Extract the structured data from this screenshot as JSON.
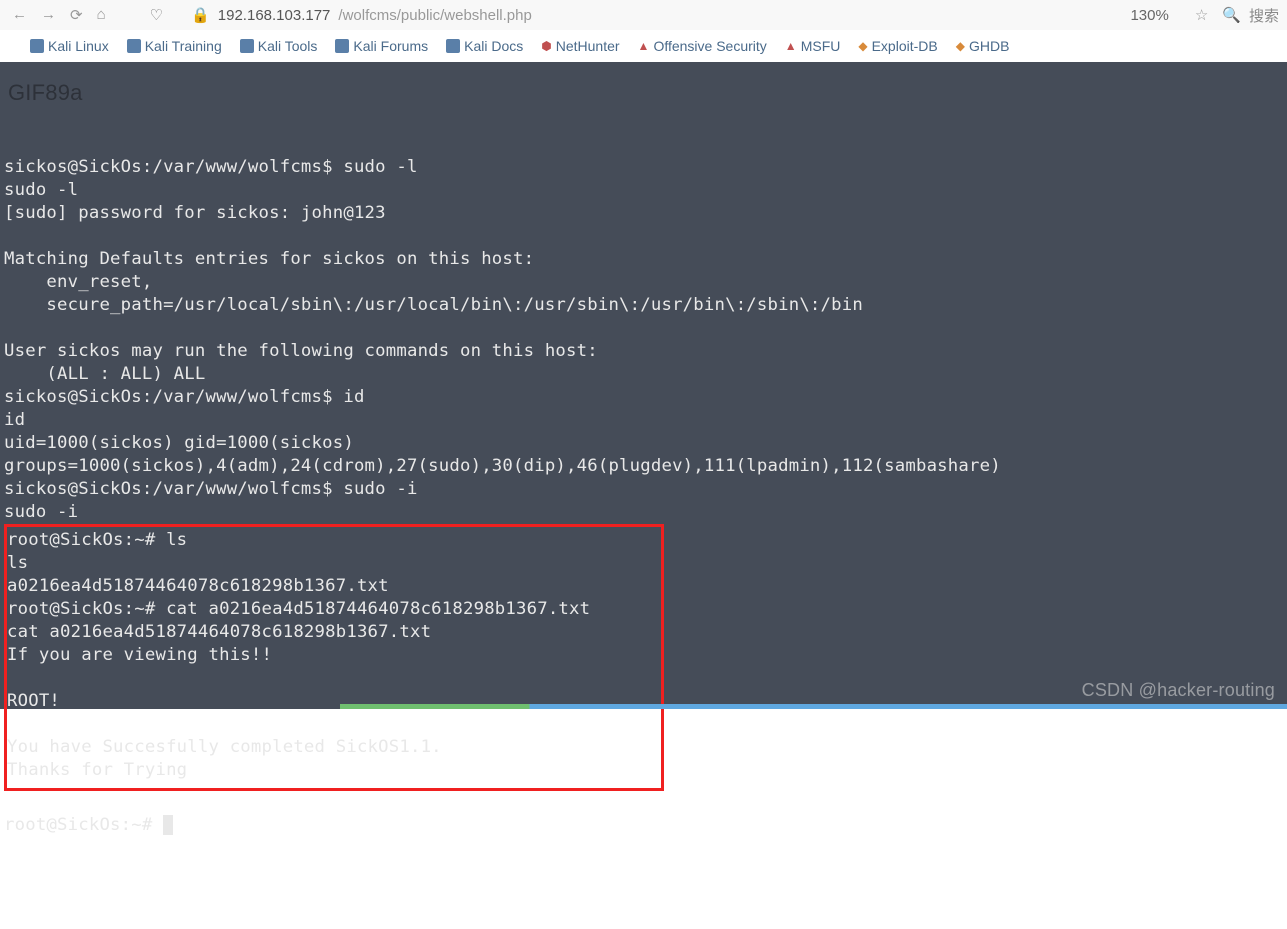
{
  "toolbar": {
    "url_host": "192.168.103.177",
    "url_path": "/wolfcms/public/webshell.php",
    "zoom": "130%",
    "search": "搜索"
  },
  "bookmarks": [
    {
      "label": "Kali Linux",
      "icon": "kali"
    },
    {
      "label": "Kali Training",
      "icon": "kali"
    },
    {
      "label": "Kali Tools",
      "icon": "kali"
    },
    {
      "label": "Kali Forums",
      "icon": "kali"
    },
    {
      "label": "Kali Docs",
      "icon": "kali"
    },
    {
      "label": "NetHunter",
      "icon": "red"
    },
    {
      "label": "Offensive Security",
      "icon": "red"
    },
    {
      "label": "MSFU",
      "icon": "red"
    },
    {
      "label": "Exploit-DB",
      "icon": "orange"
    },
    {
      "label": "GHDB",
      "icon": "orange"
    }
  ],
  "gif_text": "GIF89a",
  "terminal": {
    "line1": "sickos@SickOs:/var/www/wolfcms$ sudo -l",
    "line2": "sudo -l",
    "line3": "[sudo] password for sickos: john@123",
    "line4": "",
    "line5": "Matching Defaults entries for sickos on this host:",
    "line6": "    env_reset,",
    "line7": "    secure_path=/usr/local/sbin\\:/usr/local/bin\\:/usr/sbin\\:/usr/bin\\:/sbin\\:/bin",
    "line8": "",
    "line9": "User sickos may run the following commands on this host:",
    "line10": "    (ALL : ALL) ALL",
    "line11": "sickos@SickOs:/var/www/wolfcms$ id",
    "line12": "id",
    "line13": "uid=1000(sickos) gid=1000(sickos) groups=1000(sickos),4(adm),24(cdrom),27(sudo),30(dip),46(plugdev),111(lpadmin),112(sambashare)",
    "line14": "sickos@SickOs:/var/www/wolfcms$ sudo -i",
    "line15": "sudo -i",
    "box1": "root@SickOs:~# ls",
    "box2": "ls",
    "box3": "a0216ea4d51874464078c618298b1367.txt",
    "box4": "root@SickOs:~# cat a0216ea4d51874464078c618298b1367.txt",
    "box5": "cat a0216ea4d51874464078c618298b1367.txt",
    "box6": "If you are viewing this!!",
    "box7": "",
    "box8": "ROOT!",
    "box9": "",
    "box10": "You have Succesfully completed SickOS1.1.",
    "box11": "Thanks for Trying",
    "box12": "",
    "prompt": "root@SickOs:~# "
  },
  "watermark": "CSDN @hacker-routing"
}
